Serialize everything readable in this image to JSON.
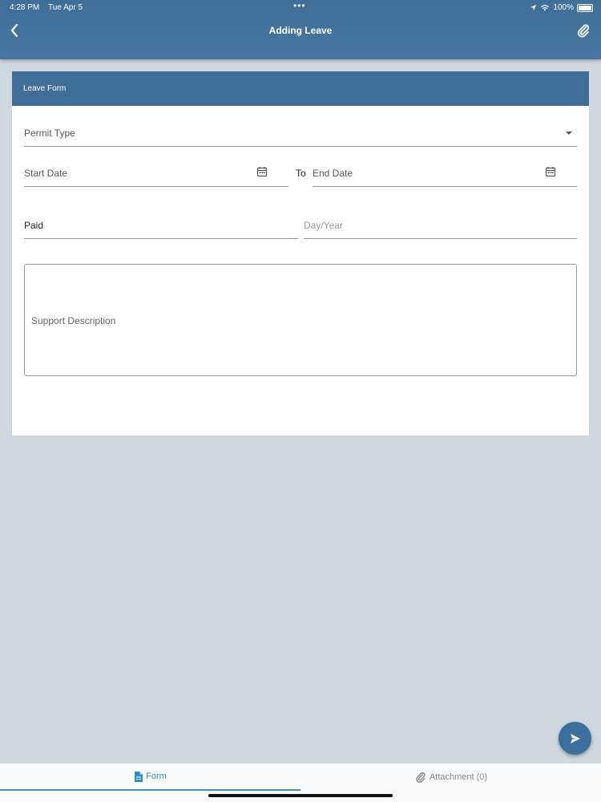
{
  "status_bar": {
    "time": "4:28 PM",
    "date": "Tue Apr 5",
    "battery": "100%"
  },
  "header": {
    "title": "Adding Leave"
  },
  "form": {
    "section_title": "Leave Form",
    "permit_type_placeholder": "Permit Type",
    "start_date_placeholder": "Start Date",
    "to_label": "To",
    "end_date_placeholder": "End Date",
    "paid_value": "Paid",
    "day_year_placeholder": "Day/Year",
    "support_description_placeholder": "Support Description"
  },
  "tabs": [
    {
      "label": "Form",
      "icon": "document-icon",
      "selected": true
    },
    {
      "label": "Attachment (0)",
      "icon": "paperclip-icon",
      "selected": false
    }
  ],
  "colors": {
    "header": "#3f6f98",
    "background": "#d0d8df",
    "accent": "#2f8ccf",
    "fab": "#3a6f9e"
  }
}
